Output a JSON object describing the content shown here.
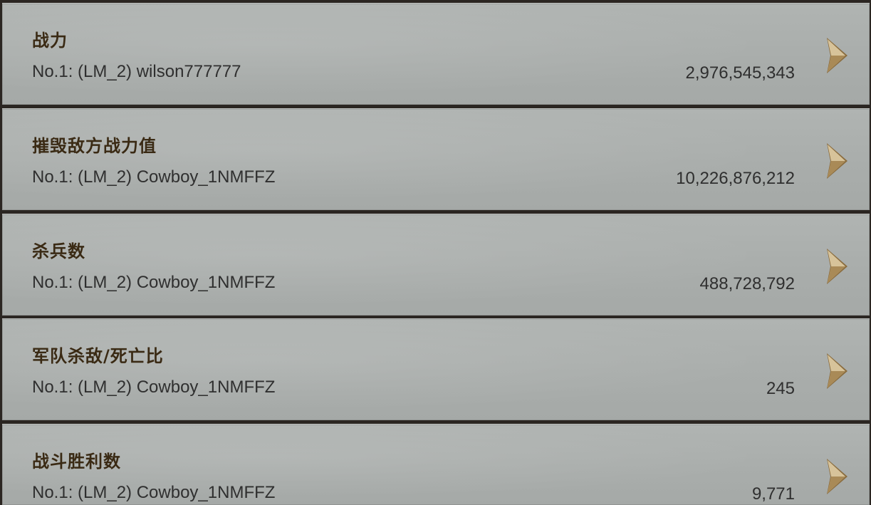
{
  "rankings": [
    {
      "title": "战力",
      "leader": "No.1: (LM_2) wilson777777",
      "value": "2,976,545,343"
    },
    {
      "title": "摧毁敌方战力值",
      "leader": "No.1: (LM_2) Cowboy_1NMFFZ",
      "value": "10,226,876,212"
    },
    {
      "title": "杀兵数",
      "leader": "No.1: (LM_2) Cowboy_1NMFFZ",
      "value": "488,728,792"
    },
    {
      "title": "军队杀敌/死亡比",
      "leader": "No.1: (LM_2) Cowboy_1NMFFZ",
      "value": "245"
    },
    {
      "title": "战斗胜利数",
      "leader": "No.1: (LM_2) Cowboy_1NMFFZ",
      "value": "9,771"
    }
  ],
  "icons": {
    "row_arrow": "chevron-right-icon"
  },
  "colors": {
    "row_background": "#abafad",
    "title_text": "#3a2a14",
    "body_text": "#2f2f2f",
    "separator": "#2b2622",
    "chevron_gold": "#b89a6a"
  }
}
